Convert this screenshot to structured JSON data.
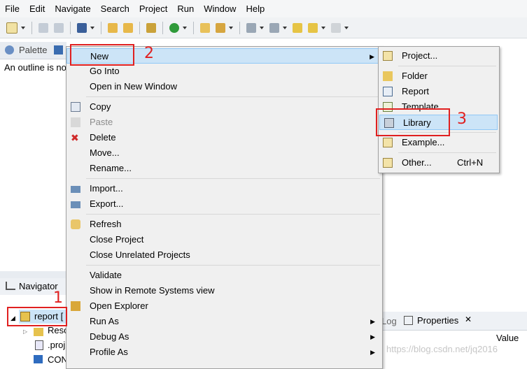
{
  "menubar": [
    "File",
    "Edit",
    "Navigate",
    "Search",
    "Project",
    "Run",
    "Window",
    "Help"
  ],
  "left": {
    "palette_tab": "Palette",
    "outline_message": "An outline is no",
    "navigator_tab": "Navigator",
    "tree": {
      "root": "report [",
      "children": [
        "Reso",
        ".proj",
        "CON"
      ]
    }
  },
  "context_menu": {
    "items": {
      "new": "New",
      "go_into": "Go Into",
      "open_new_window": "Open in New Window",
      "copy": "Copy",
      "paste": "Paste",
      "delete": "Delete",
      "move": "Move...",
      "rename": "Rename...",
      "import": "Import...",
      "export": "Export...",
      "refresh": "Refresh",
      "close_project": "Close Project",
      "close_unrelated": "Close Unrelated Projects",
      "validate": "Validate",
      "show_remote": "Show in Remote Systems view",
      "open_explorer": "Open Explorer",
      "run_as": "Run As",
      "debug_as": "Debug As",
      "profile_as": "Profile As"
    }
  },
  "submenu": {
    "project": "Project...",
    "folder": "Folder",
    "report": "Report",
    "template": "Template",
    "library": "Library",
    "example": "Example...",
    "other": "Other...",
    "other_shortcut": "Ctrl+N"
  },
  "right_panel": {
    "log_tab": "Log",
    "properties_tab": "Properties",
    "value_header": "Value"
  },
  "annotations": {
    "n1": "1",
    "n2": "2",
    "n3": "3"
  },
  "watermark": "https://blog.csdn.net/jq2016",
  "colors": {
    "highlight": "#cce4f7",
    "annotation": "#e02020",
    "menu_bg": "#f0f0f0"
  }
}
